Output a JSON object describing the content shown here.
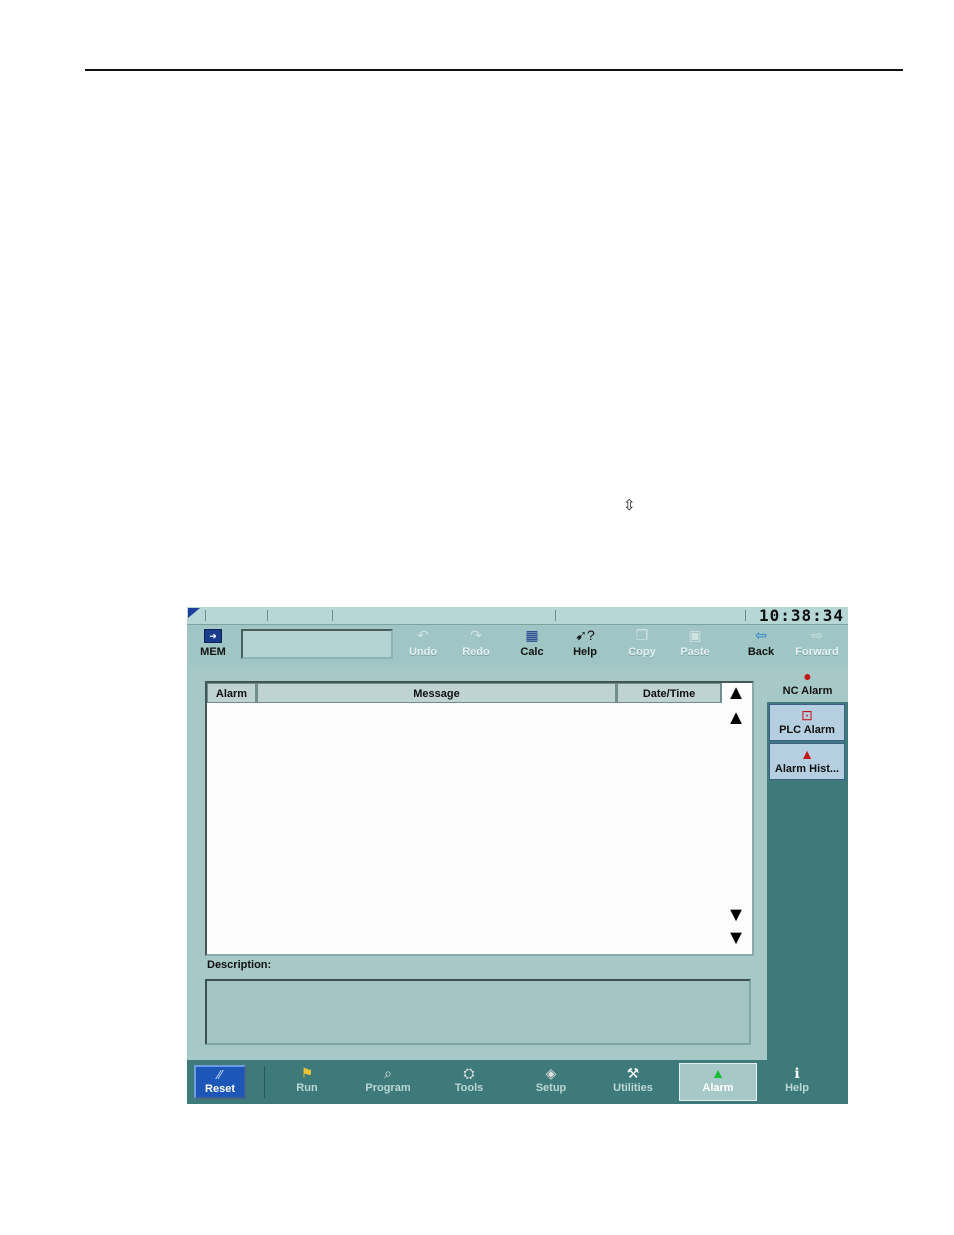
{
  "statusbar": {
    "clock": "10:38:34"
  },
  "toolbar": {
    "mode": "MEM",
    "buttons": [
      {
        "label": "Undo",
        "icon": "undo-icon",
        "enabled": false
      },
      {
        "label": "Redo",
        "icon": "redo-icon",
        "enabled": false
      },
      {
        "label": "Calc",
        "icon": "calculator-icon",
        "enabled": true
      },
      {
        "label": "Help",
        "icon": "help-pointer-icon",
        "enabled": true
      },
      {
        "label": "Copy",
        "icon": "copy-icon",
        "enabled": false
      },
      {
        "label": "Paste",
        "icon": "paste-icon",
        "enabled": false
      },
      {
        "label": "Back",
        "icon": "back-arrow-icon",
        "enabled": true
      },
      {
        "label": "Forward",
        "icon": "forward-arrow-icon",
        "enabled": false
      }
    ]
  },
  "alarm_table": {
    "columns": [
      "Alarm",
      "Message",
      "Date/Time"
    ],
    "rows": []
  },
  "description": {
    "label": "Description:"
  },
  "side_tabs": [
    {
      "label": "NC Alarm",
      "icon": "alarm-light-icon",
      "active": true
    },
    {
      "label": "PLC Alarm",
      "icon": "plc-alarm-icon",
      "active": false
    },
    {
      "label": "Alarm Hist...",
      "icon": "alarm-history-icon",
      "active": false
    }
  ],
  "bottom_nav": {
    "reset": "Reset",
    "items": [
      {
        "label": "Run",
        "icon": "run-icon",
        "active": false
      },
      {
        "label": "Program",
        "icon": "program-icon",
        "active": false
      },
      {
        "label": "Tools",
        "icon": "tools-icon",
        "active": false
      },
      {
        "label": "Setup",
        "icon": "setup-icon",
        "active": false
      },
      {
        "label": "Utilities",
        "icon": "utilities-icon",
        "active": false
      },
      {
        "label": "Alarm",
        "icon": "alarm-bell-icon",
        "active": true
      },
      {
        "label": "Help",
        "icon": "info-icon",
        "active": false
      }
    ]
  },
  "colors": {
    "screen_bg": "#9fc5c4",
    "nav_bg": "#3f7a7a",
    "reset_blue": "#1b56b8",
    "alarm_red": "#c41818"
  }
}
